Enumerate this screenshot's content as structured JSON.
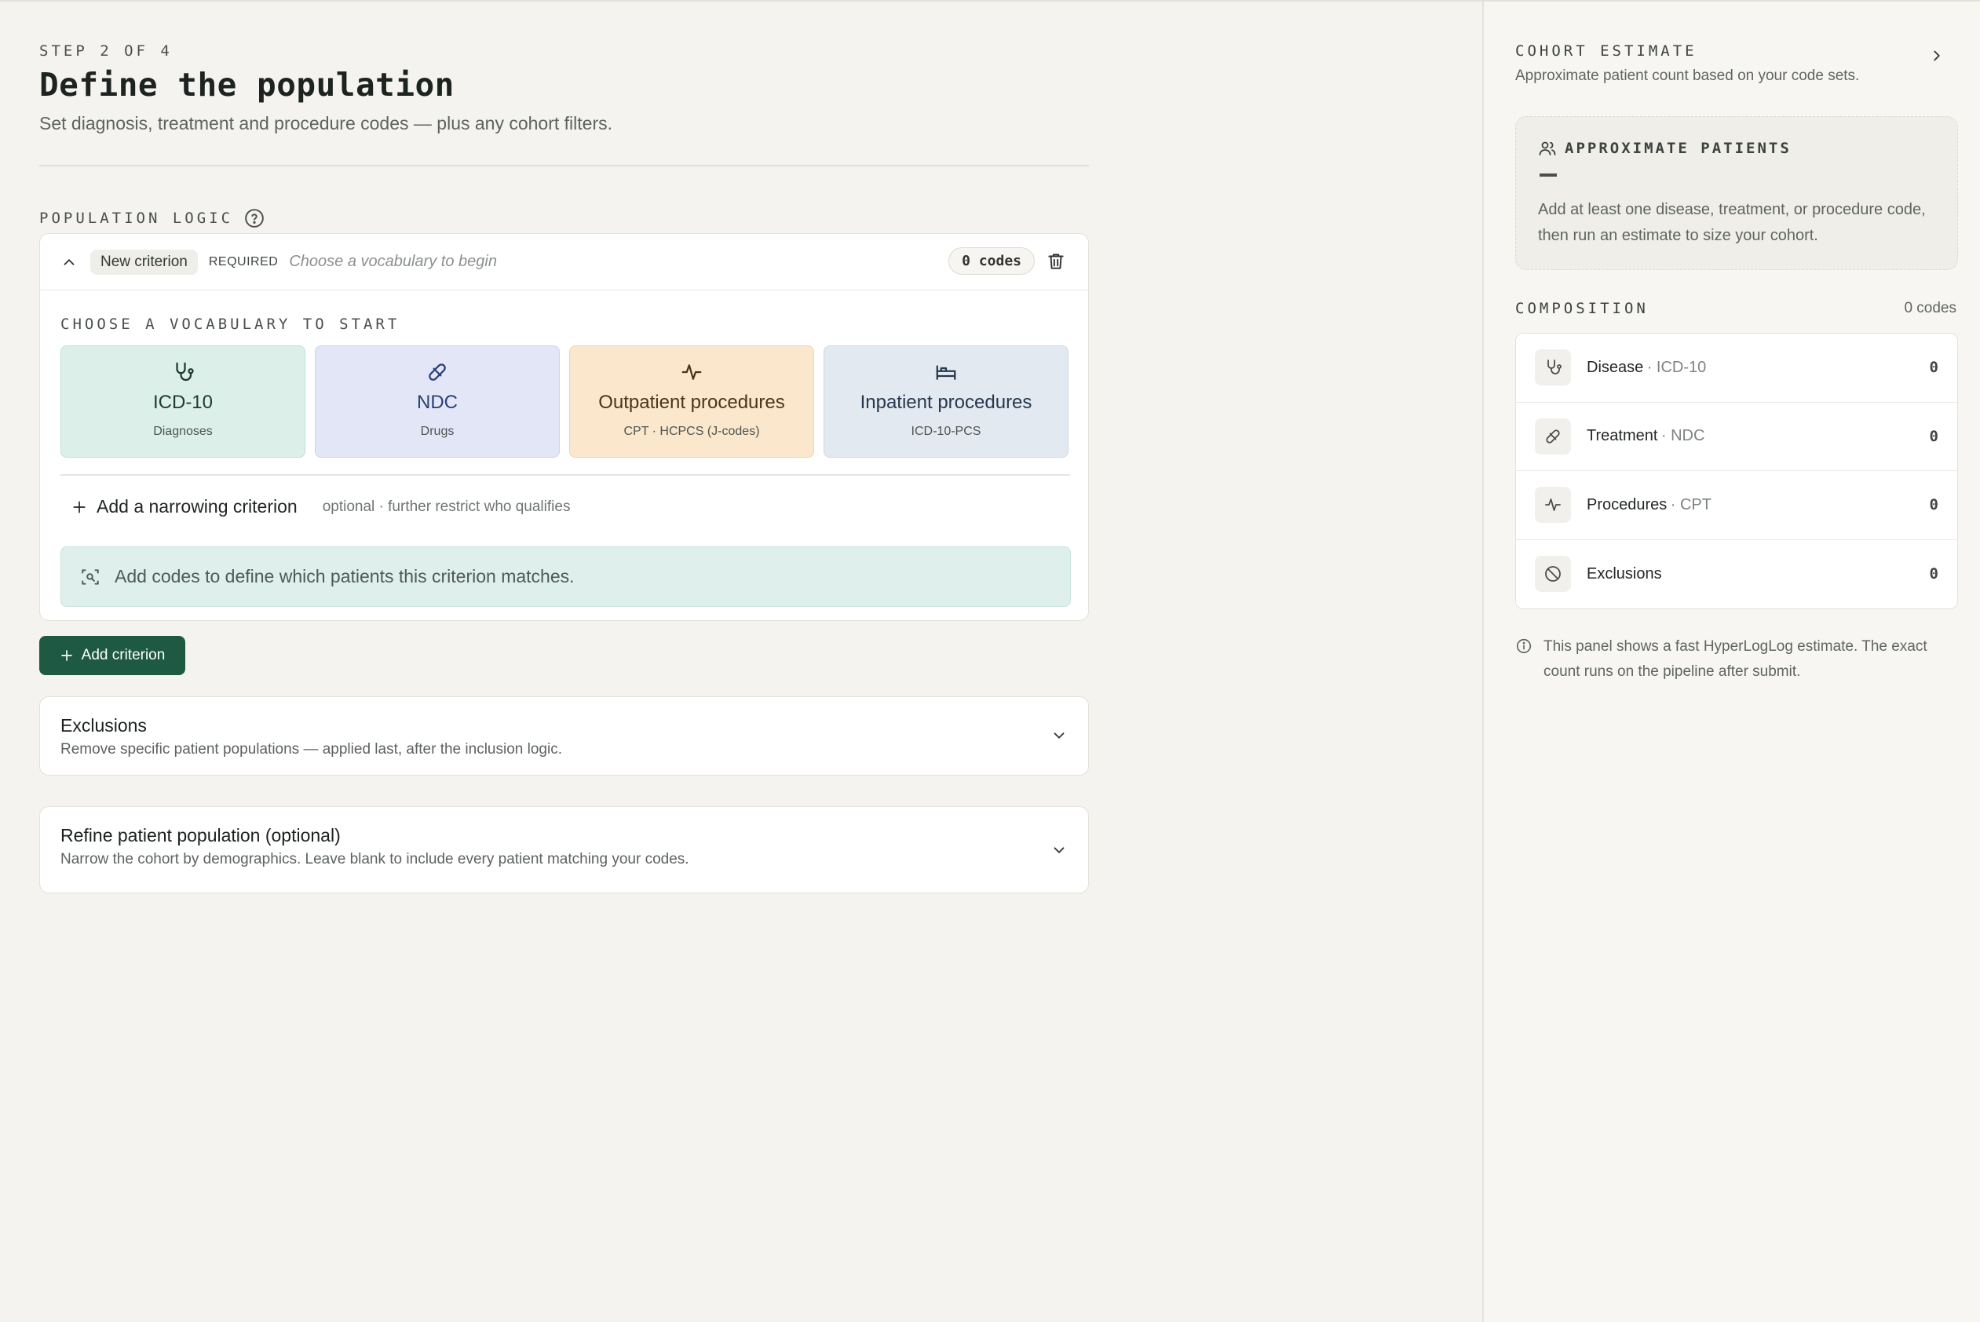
{
  "header": {
    "step": "STEP 2 OF 4",
    "title": "Define the population",
    "subtitle": "Set diagnosis, treatment and procedure codes — plus any cohort filters."
  },
  "population": {
    "section_label": "POPULATION LOGIC",
    "criterion": {
      "name": "New criterion",
      "required": "REQUIRED",
      "hint": "Choose a vocabulary to begin",
      "codes_badge": "0 codes",
      "vocab_label": "CHOOSE A VOCABULARY TO START",
      "vocabularies": [
        {
          "title": "ICD-10",
          "sub": "Diagnoses",
          "icon": "stethoscope-icon"
        },
        {
          "title": "NDC",
          "sub": "Drugs",
          "icon": "pill-icon"
        },
        {
          "title": "Outpatient procedures",
          "sub": "CPT · HCPCS (J-codes)",
          "icon": "activity-icon"
        },
        {
          "title": "Inpatient procedures",
          "sub": "ICD-10-PCS",
          "icon": "bed-icon"
        }
      ],
      "narrowing_label": "Add a narrowing criterion",
      "narrowing_note": "optional · further restrict who qualifies",
      "match_text": "Add codes to define which patients this criterion matches."
    },
    "add_criterion": "Add criterion",
    "exclusions": {
      "title": "Exclusions",
      "subtitle": "Remove specific patient populations — applied last, after the inclusion logic."
    },
    "refine": {
      "title": "Refine patient population (optional)",
      "subtitle": "Narrow the cohort by demographics. Leave blank to include every patient matching your codes."
    }
  },
  "side": {
    "title": "COHORT ESTIMATE",
    "subtitle": "Approximate patient count based on your code sets.",
    "approx": {
      "label": "APPROXIMATE PATIENTS",
      "text": "Add at least one disease, treatment, or procedure code, then run an estimate to size your cohort."
    },
    "composition": {
      "label": "COMPOSITION",
      "count": "0 codes",
      "rows": [
        {
          "name": "Disease",
          "vocab": "· ICD-10",
          "value": "0",
          "icon": "stethoscope-icon"
        },
        {
          "name": "Treatment",
          "vocab": "· NDC",
          "value": "0",
          "icon": "pill-icon"
        },
        {
          "name": "Procedures",
          "vocab": "· CPT",
          "value": "0",
          "icon": "activity-icon"
        },
        {
          "name": "Exclusions",
          "vocab": "",
          "value": "0",
          "icon": "ban-icon"
        }
      ]
    },
    "note": "This panel shows a fast HyperLogLog estimate. The exact count runs on the pipeline after submit."
  },
  "colors": {
    "primary_button": "#1e5a43",
    "icd_card": "#dcefe9",
    "ndc_card": "#e3e6f7",
    "outpatient_card": "#fbe7cc",
    "inpatient_card": "#e3e9f1"
  }
}
